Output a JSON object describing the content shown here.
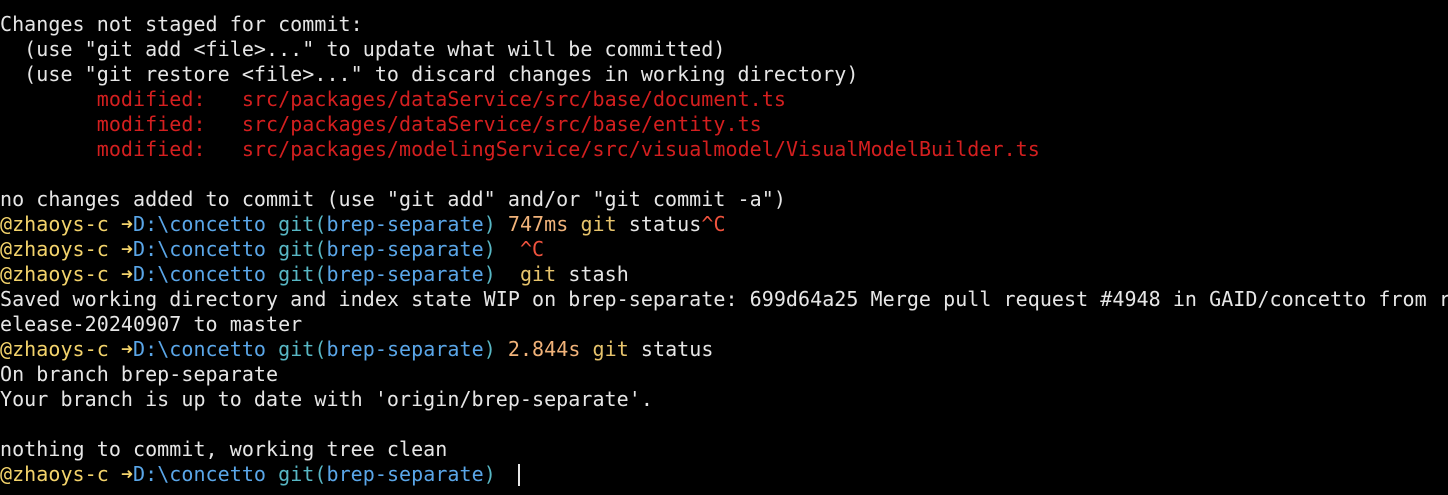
{
  "colors": {
    "background": "#000000",
    "text": "#e6e6e6",
    "modified": "#d41f1f",
    "ctrl_c": "#f0533e",
    "user": "#f3d36b",
    "path": "#5aa6e8",
    "git_label": "#58b7c4",
    "duration": "#f1b37a",
    "command": "#e6c36c"
  },
  "status_header": {
    "title": "Changes not staged for commit:",
    "hint_add": "  (use \"git add <file>...\" to update what will be committed)",
    "hint_restore": "  (use \"git restore <file>...\" to discard changes in working directory)"
  },
  "modified_files": [
    {
      "label": "modified:",
      "path": "src/packages/dataService/src/base/document.ts"
    },
    {
      "label": "modified:",
      "path": "src/packages/dataService/src/base/entity.ts"
    },
    {
      "label": "modified:",
      "path": "src/packages/modelingService/src/visualmodel/VisualModelBuilder.ts"
    }
  ],
  "no_changes_msg": "no changes added to commit (use \"git add\" and/or \"git commit -a\")",
  "prompt": {
    "user": "@zhaoys-c",
    "arrow": "➜",
    "path": "D:\\concetto",
    "git_open": "git(",
    "branch": "brep-separate",
    "git_close": ")"
  },
  "commands": [
    {
      "duration": "747ms",
      "cmd": "git",
      "args": " status",
      "ctrl": "^C"
    },
    {
      "duration": "",
      "cmd": "",
      "args": "",
      "ctrl": "^C"
    },
    {
      "duration": "",
      "cmd": "git",
      "args": " stash",
      "ctrl": ""
    },
    {
      "duration": "2.844s",
      "cmd": "git",
      "args": " status",
      "ctrl": ""
    }
  ],
  "stash_output": {
    "line1": "Saved working directory and index state WIP on brep-separate: 699d64a25 Merge pull request #4948 in GAID/concetto from r",
    "line2": "elease-20240907 to master"
  },
  "status_output": {
    "branch_line": "On branch brep-separate",
    "uptodate_line": "Your branch is up to date with 'origin/brep-separate'.",
    "clean_line": "nothing to commit, working tree clean"
  }
}
